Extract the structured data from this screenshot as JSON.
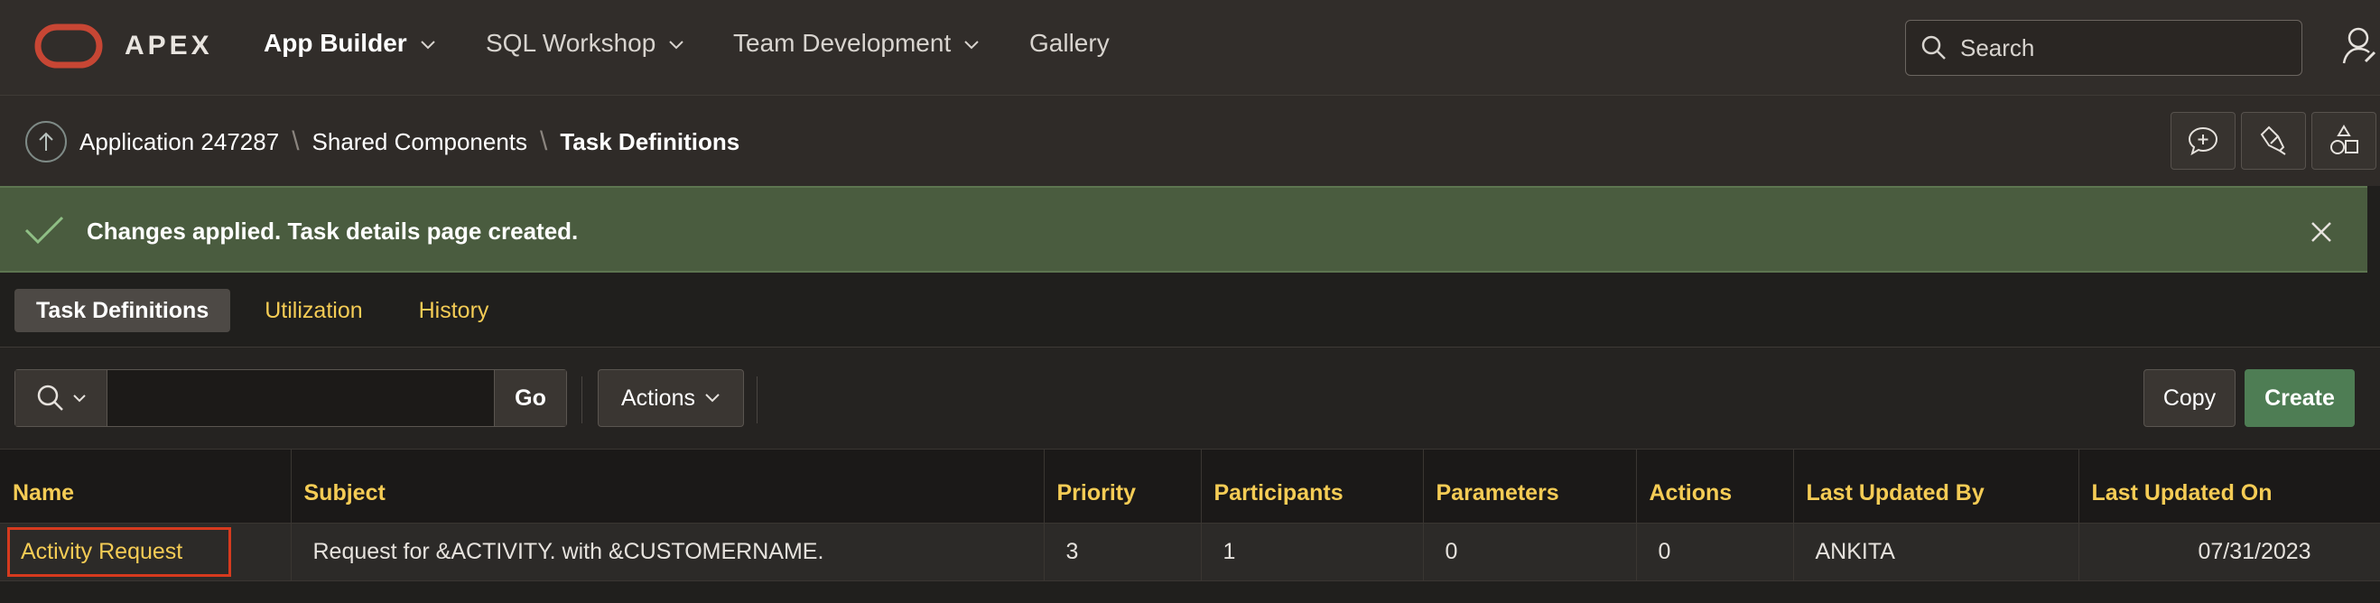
{
  "topbar": {
    "brand": "APEX",
    "nav": [
      {
        "label": "App Builder",
        "active": true
      },
      {
        "label": "SQL Workshop",
        "active": false
      },
      {
        "label": "Team Development",
        "active": false
      },
      {
        "label": "Gallery",
        "active": false
      }
    ],
    "search_placeholder": "Search"
  },
  "breadcrumb": {
    "items": [
      "Application 247287",
      "Shared Components"
    ],
    "current": "Task Definitions"
  },
  "toolbar_icons": [
    "comment-add-icon",
    "flashlight-icon",
    "shapes-icon"
  ],
  "alert": {
    "message": "Changes applied. Task details page created.",
    "color": "#4a5c3f"
  },
  "tabs": [
    {
      "label": "Task Definitions",
      "active": true
    },
    {
      "label": "Utilization",
      "active": false
    },
    {
      "label": "History",
      "active": false
    }
  ],
  "report_toolbar": {
    "go_label": "Go",
    "actions_label": "Actions",
    "copy_label": "Copy",
    "create_label": "Create"
  },
  "table": {
    "columns": [
      "Name",
      "Subject",
      "Priority",
      "Participants",
      "Parameters",
      "Actions",
      "Last Updated By",
      "Last Updated On"
    ],
    "rows": [
      {
        "name": "Activity Request",
        "subject": "Request for &ACTIVITY. with &CUSTOMERNAME.",
        "priority": "3",
        "participants": "1",
        "parameters": "0",
        "actions": "0",
        "last_updated_by": "ANKITA",
        "last_updated_on": "07/31/2023"
      }
    ]
  },
  "colors": {
    "accent_link": "#f5cc55",
    "create_button": "#4e7d54",
    "highlight_border": "#d63a1e",
    "logo": "#c74634"
  }
}
